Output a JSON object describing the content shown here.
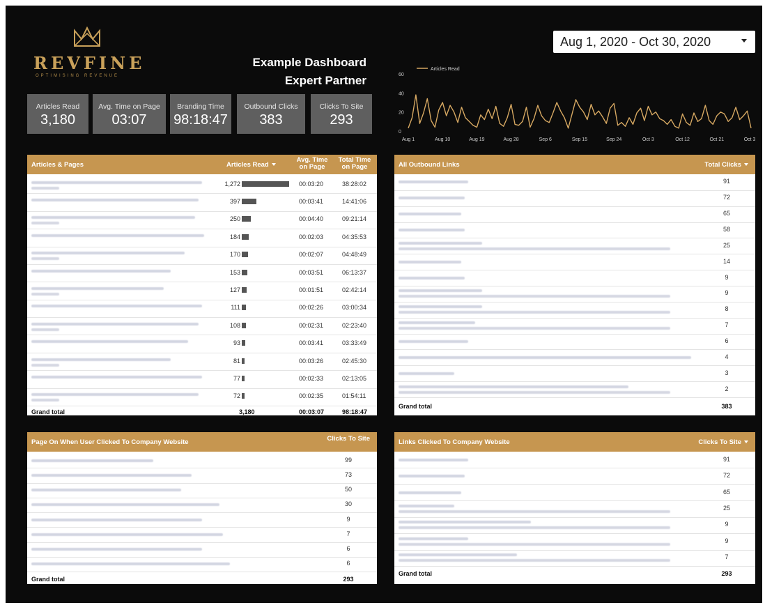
{
  "brand": {
    "name": "REVFINE",
    "tagline": "OPTIMISING REVENUE",
    "accent": "#c69650"
  },
  "header": {
    "title_line1": "Example Dashboard",
    "title_line2": "Expert Partner"
  },
  "date_range": {
    "label": "Aug 1, 2020 - Oct 30, 2020"
  },
  "kpis": [
    {
      "label": "Articles Read",
      "value": "3,180"
    },
    {
      "label": "Avg. Time on Page",
      "value": "03:07"
    },
    {
      "label": "Branding Time",
      "value": "98:18:47"
    },
    {
      "label": "Outbound Clicks",
      "value": "383"
    },
    {
      "label": "Clicks To Site",
      "value": "293"
    }
  ],
  "chart_data": {
    "type": "line",
    "legend": [
      "Articles Read"
    ],
    "legend_position": "top-left",
    "x_tick_labels": [
      "Aug 1",
      "Aug 10",
      "Aug 19",
      "Aug 28",
      "Sep 6",
      "Sep 15",
      "Sep 24",
      "Oct 3",
      "Oct 12",
      "Oct 21",
      "Oct 30"
    ],
    "y_tick_labels": [
      "0",
      "20",
      "40",
      "60"
    ],
    "ylim": [
      0,
      60
    ],
    "series": [
      {
        "name": "Articles Read",
        "color": "#d6a862",
        "values": [
          3,
          14,
          38,
          8,
          19,
          34,
          11,
          4,
          22,
          30,
          16,
          27,
          20,
          9,
          25,
          14,
          10,
          6,
          4,
          17,
          12,
          23,
          13,
          26,
          8,
          5,
          14,
          28,
          7,
          6,
          10,
          25,
          4,
          13,
          27,
          16,
          11,
          9,
          19,
          30,
          21,
          14,
          3,
          18,
          33,
          25,
          20,
          12,
          28,
          17,
          21,
          15,
          8,
          24,
          29,
          6,
          9,
          5,
          14,
          7,
          19,
          24,
          11,
          26,
          17,
          20,
          13,
          11,
          7,
          12,
          5,
          3,
          18,
          9,
          6,
          19,
          10,
          13,
          27,
          11,
          7,
          16,
          20,
          18,
          10,
          14,
          25,
          12,
          16,
          21,
          3
        ]
      }
    ]
  },
  "articles_table": {
    "headers": {
      "page": "Articles & Pages",
      "read": "Articles Read",
      "avg": "Avg. Time on Page",
      "total": "Total Time on Page"
    },
    "rows": [
      {
        "read": "1,272",
        "read_value": 1272,
        "avg": "00:03:20",
        "total": "38:28:02"
      },
      {
        "read": "397",
        "read_value": 397,
        "avg": "00:03:41",
        "total": "14:41:06"
      },
      {
        "read": "250",
        "read_value": 250,
        "avg": "00:04:40",
        "total": "09:21:14"
      },
      {
        "read": "184",
        "read_value": 184,
        "avg": "00:02:03",
        "total": "04:35:53"
      },
      {
        "read": "170",
        "read_value": 170,
        "avg": "00:02:07",
        "total": "04:48:49"
      },
      {
        "read": "153",
        "read_value": 153,
        "avg": "00:03:51",
        "total": "06:13:37"
      },
      {
        "read": "127",
        "read_value": 127,
        "avg": "00:01:51",
        "total": "02:42:14"
      },
      {
        "read": "111",
        "read_value": 111,
        "avg": "00:02:26",
        "total": "03:00:34"
      },
      {
        "read": "108",
        "read_value": 108,
        "avg": "00:02:31",
        "total": "02:23:40"
      },
      {
        "read": "93",
        "read_value": 93,
        "avg": "00:03:41",
        "total": "03:33:49"
      },
      {
        "read": "81",
        "read_value": 81,
        "avg": "00:03:26",
        "total": "02:45:30"
      },
      {
        "read": "77",
        "read_value": 77,
        "avg": "00:02:33",
        "total": "02:13:05"
      },
      {
        "read": "72",
        "read_value": 72,
        "avg": "00:02:35",
        "total": "01:54:11"
      }
    ],
    "grand_total": {
      "label": "Grand total",
      "read": "3,180",
      "avg": "00:03:07",
      "total": "98:18:47"
    }
  },
  "outbound_table": {
    "headers": {
      "link": "All Outbound Links",
      "clicks": "Total Clicks"
    },
    "rows": [
      "91",
      "72",
      "65",
      "58",
      "25",
      "14",
      "9",
      "9",
      "8",
      "7",
      "6",
      "4",
      "3",
      "2"
    ],
    "grand_total": {
      "label": "Grand total",
      "value": "383"
    }
  },
  "page_clicks_table": {
    "headers": {
      "page": "Page On When User Clicked To Company Website",
      "clicks": "Clicks To Site"
    },
    "rows": [
      "99",
      "73",
      "50",
      "30",
      "9",
      "7",
      "6",
      "6"
    ],
    "grand_total": {
      "label": "Grand total",
      "value": "293"
    }
  },
  "links_clicked_table": {
    "headers": {
      "link": "Links Clicked To Company Website",
      "clicks": "Clicks To Site"
    },
    "rows": [
      "91",
      "72",
      "65",
      "25",
      "9",
      "9",
      "7"
    ],
    "grand_total": {
      "label": "Grand total",
      "value": "293"
    }
  }
}
